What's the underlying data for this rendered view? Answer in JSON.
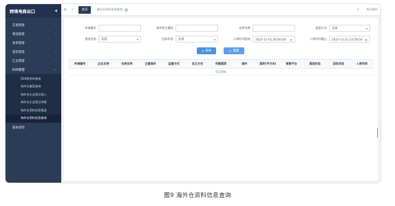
{
  "sidebar": {
    "brand": "跨境电商出口",
    "menu": [
      {
        "label": "交易管理"
      },
      {
        "label": "物流管理"
      },
      {
        "label": "清单管理"
      },
      {
        "label": "退货管理"
      },
      {
        "label": "汇总管理"
      },
      {
        "label": "B2B管理",
        "open": true
      }
    ],
    "submenu": [
      {
        "label": "B2B报关单查询"
      },
      {
        "label": "海外仓备案查询"
      },
      {
        "label": "海外仓企业登记录入"
      },
      {
        "label": "海外仓企业登记申报"
      },
      {
        "label": "海外仓资料信息报送"
      },
      {
        "label": "海外仓资料信息查询",
        "active": true
      }
    ],
    "footer_item": "版本说明"
  },
  "topbar": {
    "home_tab": "首页",
    "current_tab": "海外仓资料信息查询",
    "close_label": "×",
    "right_label": "关闭操作"
  },
  "form": {
    "apply_no_label": "申请编号",
    "overseas_reg_no_label": "海关登记编码",
    "warehouse_name_label": "仓库名称",
    "supervision_label": "监管方式",
    "supervision_value": "全部",
    "report_status_label": "报送状态",
    "report_status_value": "全部",
    "return_status_label": "回执状态",
    "return_status_value": "全部",
    "entry_start_label": "入库时间起始",
    "entry_start_value": "2022-12-01 00:00:00",
    "entry_end_label": "入库时间截止",
    "entry_end_value": "2022-12-31 23:59:59"
  },
  "buttons": {
    "search": "查询",
    "reset": "重置"
  },
  "table": {
    "columns": [
      "申请编号",
      "企业名称",
      "仓库名称",
      "主管海关",
      "监管方式",
      "设立方式",
      "所属国家",
      "城市",
      "面积(平方米)",
      "销售平台",
      "报送状态",
      "回执状态",
      "入库时间"
    ],
    "empty_text": "暂无数据"
  },
  "caption": "图9  海外仓资料信息查询"
}
